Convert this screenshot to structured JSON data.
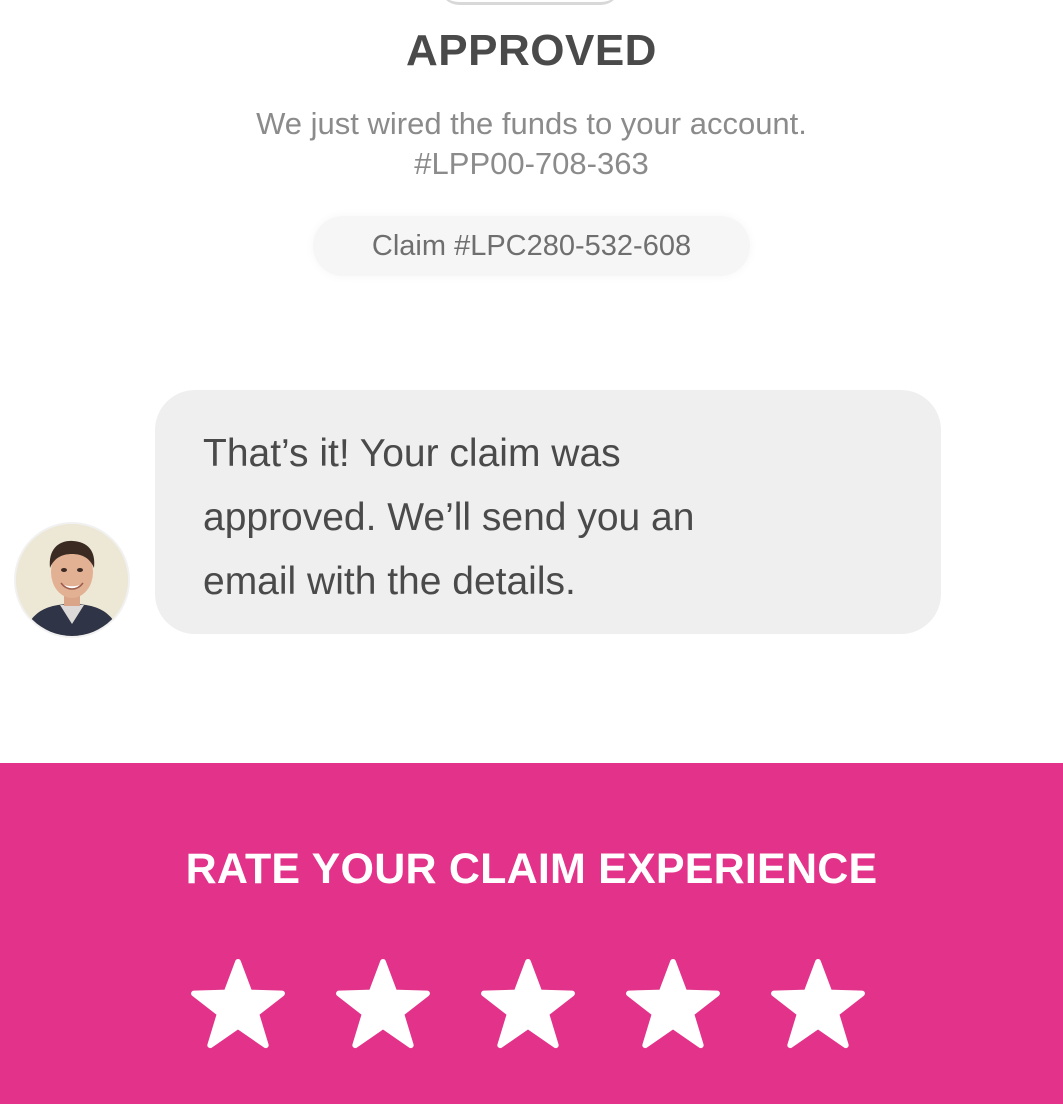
{
  "status": {
    "title": "APPROVED",
    "message": "We just wired the funds to your account.",
    "payment_ref": "#LPP00-708-363",
    "claim_label": "Claim #LPC280-532-608"
  },
  "chat": {
    "avatar_icon": "agent-photo",
    "message_lines": [
      "That’s it! Your claim was",
      "approved. We’ll send you an",
      "email with the details."
    ]
  },
  "rating": {
    "title": "RATE YOUR CLAIM EXPERIENCE",
    "star_icon": "star-icon",
    "max_stars": 5,
    "selected": 0,
    "background_color": "#e2328a",
    "star_color": "#ffffff"
  }
}
